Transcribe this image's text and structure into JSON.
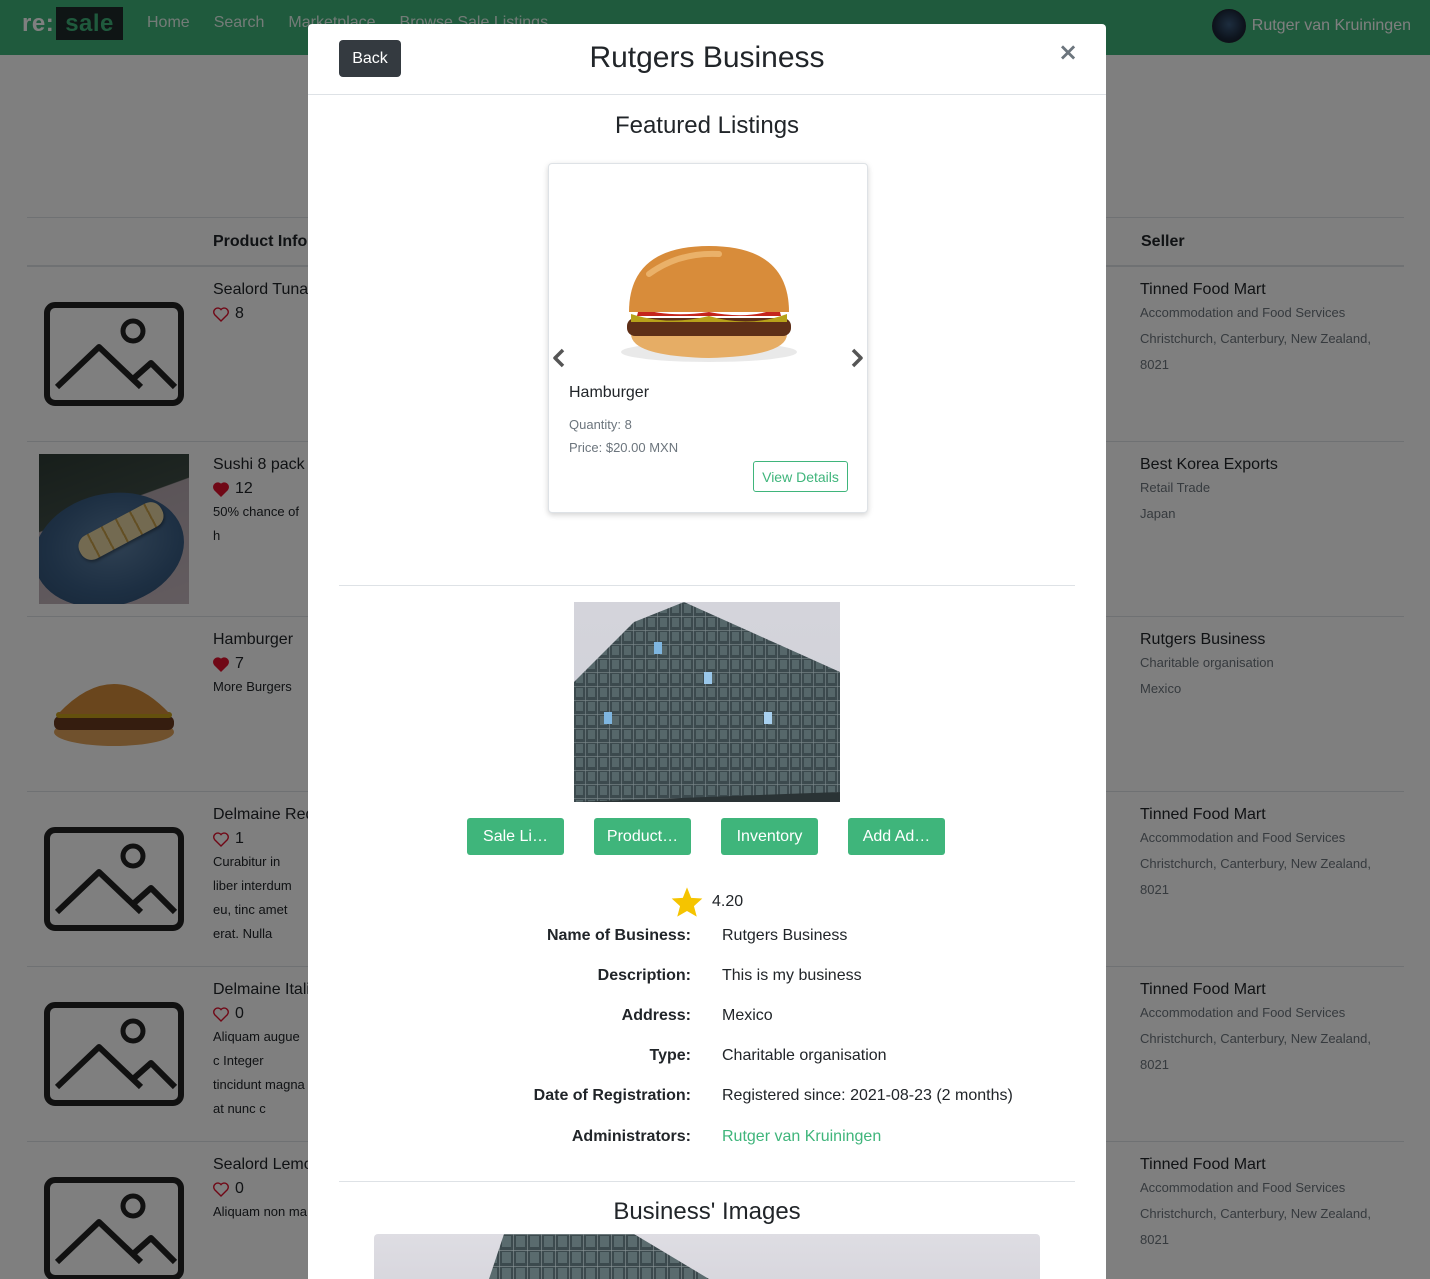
{
  "navbar": {
    "brand_re": "re:",
    "brand_sale": "sale",
    "links": [
      "Home",
      "Search",
      "Marketplace",
      "Browse Sale Listings"
    ],
    "user_name": "Rutger van Kruiningen"
  },
  "table": {
    "headers": {
      "product_info": "Product Info",
      "seller": "Seller"
    },
    "rows": [
      {
        "title": "Sealord Tuna",
        "likes": "8",
        "liked": false,
        "desc": "",
        "seller": "Tinned Food Mart",
        "seller_lines": [
          "Accommodation and Food Services",
          "Christchurch, Canterbury, New Zealand,",
          "8021"
        ]
      },
      {
        "title": "Sushi 8 pack",
        "likes": "12",
        "liked": true,
        "desc": "50% chance of h",
        "seller": "Best Korea Exports",
        "seller_lines": [
          "Retail Trade",
          "Japan"
        ]
      },
      {
        "title": "Hamburger",
        "likes": "7",
        "liked": true,
        "desc": "More Burgers",
        "seller": "Rutgers Business",
        "seller_lines": [
          "Charitable organisation",
          "Mexico"
        ]
      },
      {
        "title": "Delmaine Red",
        "likes": "1",
        "liked": false,
        "desc": "Curabitur in liber interdum eu, tinc amet erat. Nulla",
        "seller": "Tinned Food Mart",
        "seller_lines": [
          "Accommodation and Food Services",
          "Christchurch, Canterbury, New Zealand,",
          "8021"
        ]
      },
      {
        "title": "Delmaine Itali",
        "likes": "0",
        "liked": false,
        "desc": "Aliquam augue c Integer tincidunt magna at nunc c",
        "seller": "Tinned Food Mart",
        "seller_lines": [
          "Accommodation and Food Services",
          "Christchurch, Canterbury, New Zealand,",
          "8021"
        ]
      },
      {
        "title": "Sealord Lemo",
        "likes": "0",
        "liked": false,
        "desc": "Aliquam non ma",
        "seller": "Tinned Food Mart",
        "seller_lines": [
          "Accommodation and Food Services",
          "Christchurch, Canterbury, New Zealand,",
          "8021"
        ]
      }
    ]
  },
  "modal": {
    "back_label": "Back",
    "title": "Rutgers Business",
    "close_label": "×",
    "featured_title": "Featured Listings",
    "listing": {
      "name": "Hamburger",
      "quantity": "Quantity: 8",
      "price": "Price: $20.00 MXN",
      "view_label": "View Details"
    },
    "buttons": [
      "Sale Li…",
      "Product…",
      "Inventory",
      "Add Ad…"
    ],
    "rating": "4.20",
    "details": [
      {
        "label": "Name of Business:",
        "value": "Rutgers Business"
      },
      {
        "label": "Description:",
        "value": "This is my business"
      },
      {
        "label": "Address:",
        "value": "Mexico"
      },
      {
        "label": "Type:",
        "value": "Charitable organisation"
      },
      {
        "label": "Date of Registration:",
        "value": "Registered since: 2021-08-23 (2 months)"
      },
      {
        "label": "Administrators:",
        "value": "Rutger van Kruiningen"
      }
    ],
    "images_title": "Business' Images"
  },
  "colors": {
    "accent": "#3fb57b",
    "dark": "#343a40",
    "star": "#f5c400",
    "heart": "#e0102d"
  }
}
